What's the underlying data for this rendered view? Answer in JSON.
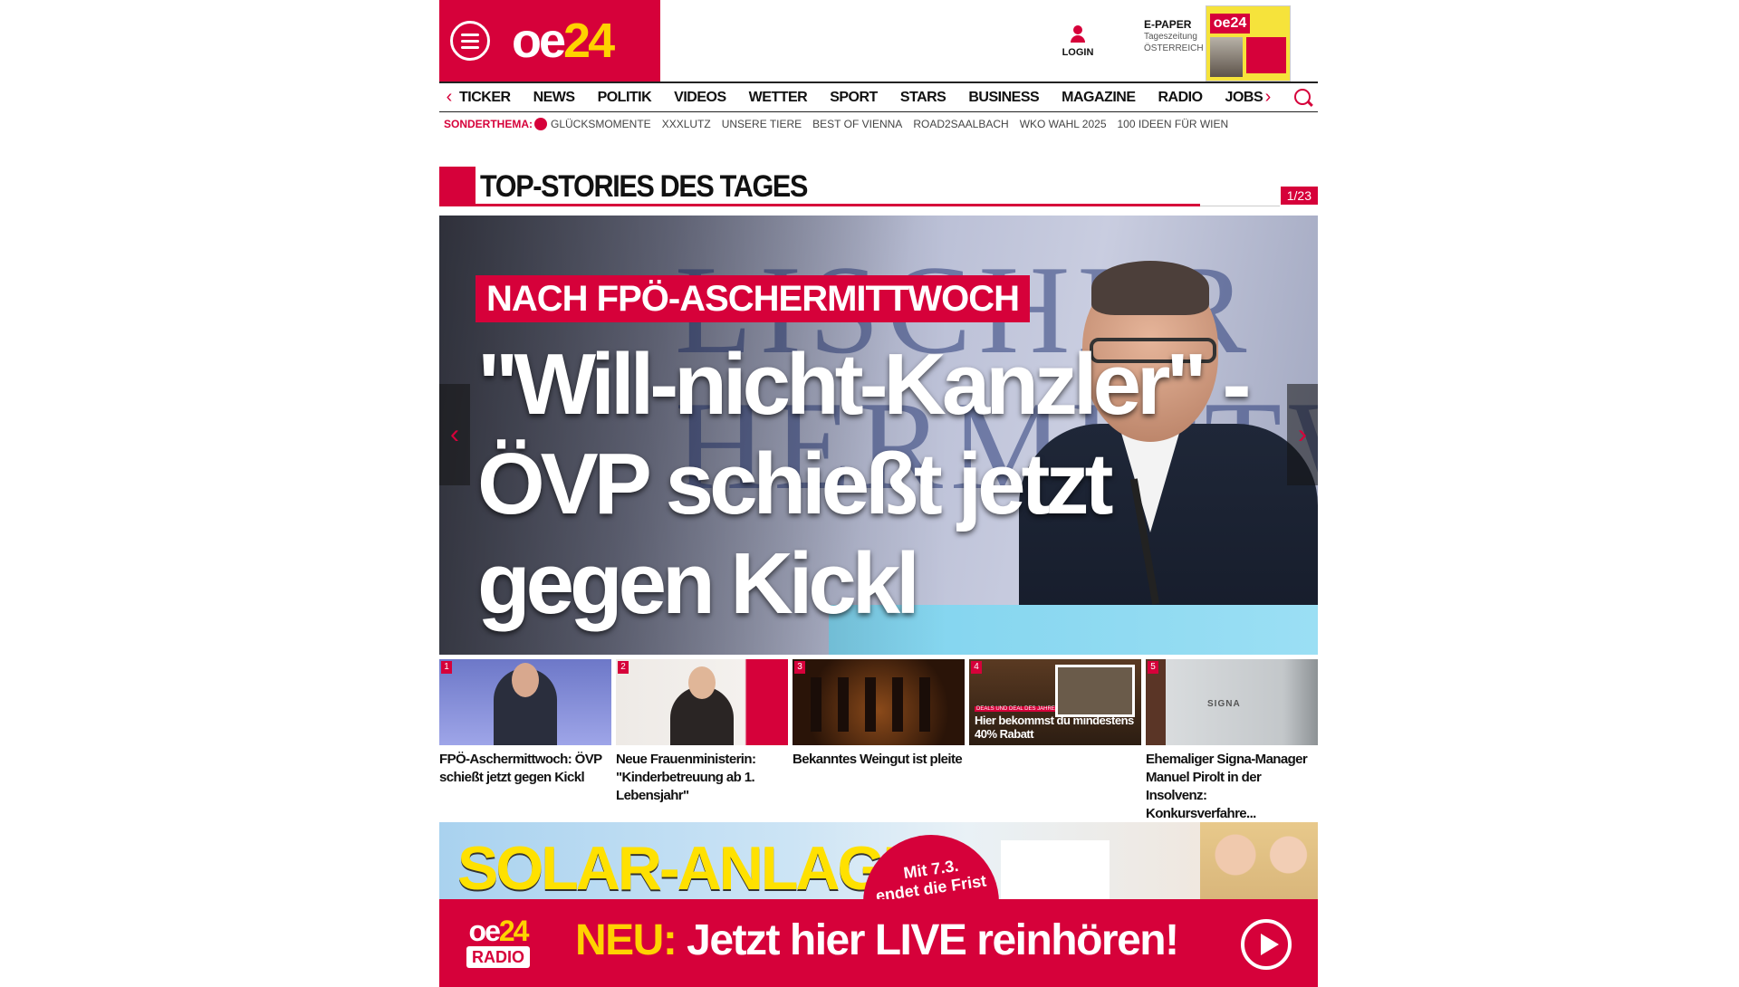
{
  "header": {
    "logo": {
      "main": "oe",
      "num": "24"
    },
    "login_label": "LOGIN",
    "epaper": {
      "title": "E-PAPER",
      "line1": "Tageszeitung",
      "line2": "ÖSTERREICH"
    }
  },
  "nav": {
    "items": [
      "TICKER",
      "NEWS",
      "POLITIK",
      "VIDEOS",
      "WETTER",
      "SPORT",
      "STARS",
      "BUSINESS",
      "MAGAZINE",
      "RADIO",
      "JOBS"
    ]
  },
  "subnav": {
    "lead": "SONDERTHEMA:",
    "items": [
      "GLÜCKSMOMENTE",
      "XXXLUTZ",
      "UNSERE TIERE",
      "BEST OF VIENNA",
      "ROAD2SAALBACH",
      "WKO WAHL 2025",
      "100 IDEEN FÜR WIEN"
    ]
  },
  "section": {
    "title": "TOP-STORIES DES TAGES",
    "counter": "1/23"
  },
  "hero": {
    "kicker": "NACH FPÖ-ASCHERMITTWOCH",
    "headline": "\"Will-nicht-Kanzler\" - ÖVP schießt jetzt gegen Kickl",
    "bg_letters": "LISCHER\nHERMITTW"
  },
  "thumbs": [
    {
      "num": "1",
      "caption": "FPÖ-Aschermittwoch: ÖVP schießt jetzt gegen Kickl"
    },
    {
      "num": "2",
      "caption": "Neue Frauenministerin: \"Kinderbetreuung ab 1. Lebensjahr\""
    },
    {
      "num": "3",
      "caption": "Bekanntes Weingut ist pleite"
    },
    {
      "num": "4",
      "caption": "",
      "promo_tag": "DEALS UND DEAL DES JAHRES",
      "promo": "Hier bekommst du mindestens 40% Rabatt"
    },
    {
      "num": "5",
      "caption": "Ehemaliger Signa-Manager Manuel Pirolt in der Insolvenz: Konkursverfahre...",
      "sign": "SIGNA"
    }
  ],
  "ads": {
    "solar": {
      "title": "SOLAR-ANLAGE",
      "badge1": "Mit 7.3.",
      "badge2": "endet die Frist"
    },
    "radio": {
      "logo_main": "oe",
      "logo_num": "24",
      "logo_sub": "RADIO",
      "neu": "NEU:",
      "message": "Jetzt hier LIVE reinhören!"
    }
  },
  "colors": {
    "brand": "#d6013a",
    "accent": "#ffd200"
  }
}
